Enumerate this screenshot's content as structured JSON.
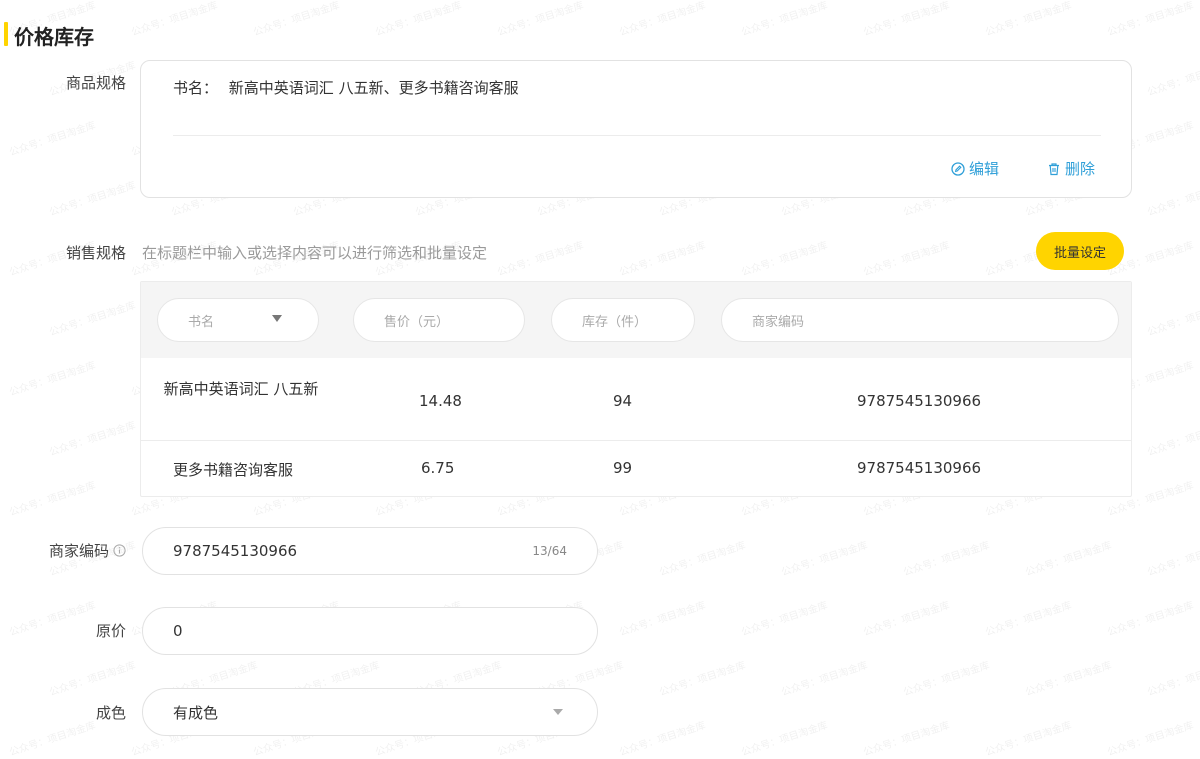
{
  "section": {
    "title": "价格库存"
  },
  "spec": {
    "label": "商品规格",
    "line_prefix": "书名：",
    "line_value": "新高中英语词汇 八五新、更多书籍咨询客服",
    "edit_label": "编辑",
    "delete_label": "删除"
  },
  "sales": {
    "label": "销售规格",
    "hint": "在标题栏中输入或选择内容可以进行筛选和批量设定",
    "batch_button": "批量设定",
    "filters": {
      "title": "书名",
      "price": "售价（元）",
      "stock": "库存（件）",
      "code": "商家编码"
    },
    "rows": [
      {
        "name": "新高中英语词汇 八五新",
        "price": "14.48",
        "stock": "94",
        "code": "9787545130966"
      },
      {
        "name": "更多书籍咨询客服",
        "price": "6.75",
        "stock": "99",
        "code": "9787545130966"
      }
    ]
  },
  "merchant_code": {
    "label": "商家编码",
    "value": "9787545130966",
    "counter": "13/64"
  },
  "original_price": {
    "label": "原价",
    "value": "0"
  },
  "condition": {
    "label": "成色",
    "value": "有成色"
  },
  "watermark": "公众号：项目淘金库",
  "colors": {
    "accent": "#ffd400",
    "link": "#2f9fd8"
  }
}
